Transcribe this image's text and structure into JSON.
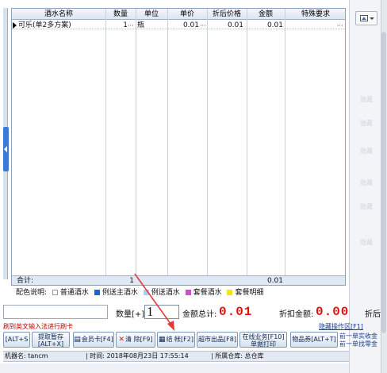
{
  "grid": {
    "columns": [
      "酒水名称",
      "数量",
      "单位",
      "单价",
      "折后价格",
      "金额",
      "特殊要求"
    ],
    "rows": [
      {
        "name": "可乐(单2多方案)",
        "qty": "1",
        "unit": "瓶",
        "price": "0.01",
        "discount_price": "0.01",
        "amount": "0.01",
        "special": ""
      }
    ],
    "ellipsis": "···",
    "total_label": "合计:",
    "total_qty": "1",
    "total_amount": "0.01"
  },
  "legend": {
    "label": "配色说明:",
    "items": [
      {
        "text": "普通酒水",
        "color": "#ffffff"
      },
      {
        "text": "例送主酒水",
        "color": "#1565e0"
      },
      {
        "text": "例送酒水",
        "color": "#a8d0f5"
      },
      {
        "text": "套餐酒水",
        "color": "#d24bd2"
      },
      {
        "text": "套餐明细",
        "color": "#f5e60a"
      }
    ]
  },
  "inputs": {
    "qty_label": "数量[+]:",
    "qty_value": "1",
    "total_label": "金额总计:",
    "total_value": "0.01",
    "discount_label": "折扣金额:",
    "discount_value": "0.00",
    "after_label": "折后金"
  },
  "hint": "刷到英文输入法进行刷卡",
  "hide_area": "隐藏操作区[F1]",
  "buttons": [
    {
      "id": "alt-s",
      "label": "[ALT+S",
      "icon": ""
    },
    {
      "id": "fetch-hold",
      "label": "提取暂存\n[ALT+X]",
      "icon": ""
    },
    {
      "id": "member-card",
      "label": "会员卡[F4]",
      "icon": "card-icon"
    },
    {
      "id": "clear",
      "label": "清  除[F9]",
      "icon": "x-icon"
    },
    {
      "id": "checkout",
      "label": "结  帐[F2]",
      "icon": "doc-icon"
    },
    {
      "id": "supermarket",
      "label": "超市出品[F8]",
      "icon": ""
    },
    {
      "id": "online-biz",
      "label": "在线业务[F10]\n单据打印",
      "icon": ""
    },
    {
      "id": "item-coupon",
      "label": "物品券[ALT+T]",
      "icon": ""
    }
  ],
  "links": [
    "前一单实收金",
    "前一单找零金"
  ],
  "status": {
    "machine": "机器名: tancm",
    "time": "| 时间: 2018年08月23日  17:55:14",
    "warehouse": "| 所属仓库: 总仓库"
  },
  "colors": {
    "accent": "#3b7ad6",
    "amount_red": "#e01010",
    "arrow_red": "#e53935"
  }
}
